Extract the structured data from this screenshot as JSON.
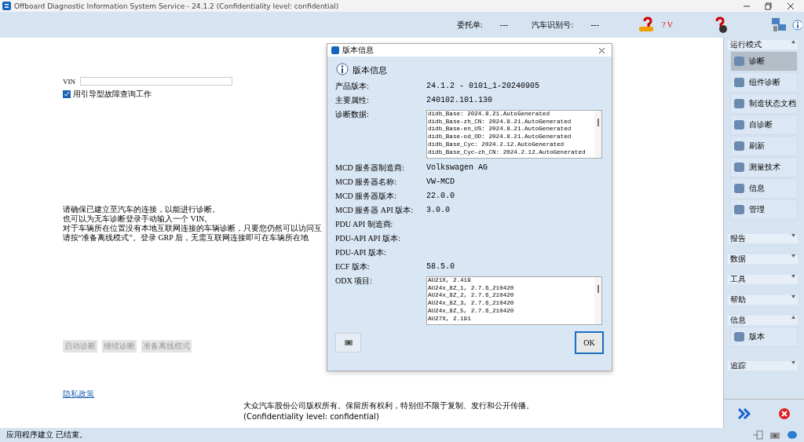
{
  "window": {
    "title": "Offboard Diagnostic Information System Service - 24.1.2 (Confidentiality level: confidential)"
  },
  "header": {
    "order_label": "委托单:",
    "order_value": "---",
    "vin_label": "汽车识别号:",
    "vin_value": "---",
    "help_text": "? V"
  },
  "main": {
    "vin_label": "VIN",
    "guided_checkbox": {
      "label": "用引导型故障查询工作",
      "checked": true
    },
    "info_lines": [
      "请确保已建立至汽车的连接，以能进行诊断。",
      "也可以为无车诊断登录手动输入一个 VIN。",
      "对于车辆所在位置没有本地互联网连接的车辆诊断，只要您仍然可以访问互",
      "请按“准备离线模式”。登录 GRP 后，无需互联网连接即可在车辆所在地"
    ],
    "buttons": [
      {
        "label": "启动诊断",
        "disabled": true
      },
      {
        "label": "继续诊断",
        "disabled": true
      },
      {
        "label": "准备离线模式",
        "disabled": true
      }
    ],
    "privacy_link": "隐私政策",
    "copyright": "大众汽车股份公司版权所有。保留所有权利，特别但不限于复制、发行和公开传播。",
    "confidentiality": "(Confidentiality level: confidential)"
  },
  "sidebar": [
    {
      "title": "运行模式",
      "expanded": true,
      "items": [
        {
          "label": "诊断",
          "selected": true
        },
        {
          "label": "组件诊断",
          "selected": false
        },
        {
          "label": "制造状态文档",
          "selected": false
        },
        {
          "label": "自诊断",
          "selected": false
        },
        {
          "label": "刷新",
          "selected": false
        },
        {
          "label": "测量技术",
          "selected": false
        },
        {
          "label": "信息",
          "selected": false
        },
        {
          "label": "管理",
          "selected": false
        }
      ]
    },
    {
      "title": "报告",
      "expanded": false
    },
    {
      "title": "数据",
      "expanded": false
    },
    {
      "title": "工具",
      "expanded": false
    },
    {
      "title": "帮助",
      "expanded": false
    },
    {
      "title": "信息",
      "expanded": true,
      "items": [
        {
          "label": "版本",
          "selected": false
        }
      ]
    },
    {
      "title": "追踪",
      "expanded": false
    }
  ],
  "status_bar": {
    "text": "应用程序建立 已结束。"
  },
  "dialog": {
    "title": "版本信息",
    "heading": "版本信息",
    "ok_label": "OK",
    "rows": [
      {
        "kind": "text",
        "label": "产品版本:",
        "value": "24.1.2   -   0101_1-20240905"
      },
      {
        "kind": "text",
        "label": "主要属性:",
        "value": "240102.101.130"
      },
      {
        "kind": "list",
        "label": "诊断数据:",
        "lines": [
          "didb_Base: 2024.8.21.AutoGenerated",
          "didb_Base-zh_CN: 2024.8.21.AutoGenerated",
          "didb_Base-en_US: 2024.8.21.AutoGenerated",
          "didb_Base-od_OD: 2024.8.21.AutoGenerated",
          "didb_Base_Cyc: 2024.2.12.AutoGenerated",
          "didb_Base_Cyc-zh_CN: 2024.2.12.AutoGenerated"
        ]
      },
      {
        "kind": "text",
        "label": "MCD 服务器制造商:",
        "value": "Volkswagen AG"
      },
      {
        "kind": "text",
        "label": "MCD 服务器名称:",
        "value": "VW-MCD"
      },
      {
        "kind": "text",
        "label": "MCD 服务器版本:",
        "value": "22.0.0"
      },
      {
        "kind": "text",
        "label": "MCD 服务器 API 版本:",
        "value": "3.0.0"
      },
      {
        "kind": "text",
        "label": "PDU API 制造商:"
      },
      {
        "kind": "text",
        "label": "PDU-API API 版本:"
      },
      {
        "kind": "text",
        "label": "PDU-API 版本:"
      },
      {
        "kind": "text",
        "label": "ECF 版本:",
        "value": "58.5.0"
      },
      {
        "kind": "list",
        "label": "ODX 项目:",
        "lines": [
          "AU21X, 2.419",
          "AU24x_8Z_1, 2.7.6_210420",
          "AU24x_8Z_2, 2.7.6_210420",
          "AU24x_8Z_3, 2.7.6_210420",
          "AU24x_8Z_5, 2.7.6_210420",
          "AU27X, 2.191"
        ]
      }
    ]
  }
}
